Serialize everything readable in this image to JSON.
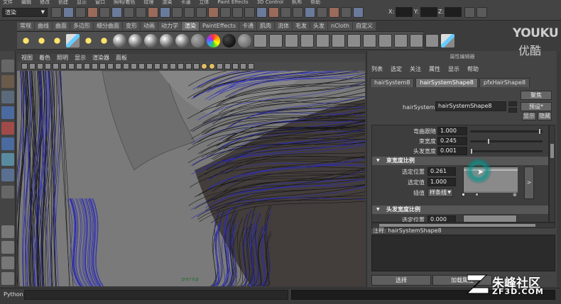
{
  "menubar": [
    "文件",
    "编辑",
    "修改",
    "创建",
    "显示",
    "窗口",
    "照明/着色",
    "纹理",
    "渲染",
    "卡通",
    "立体",
    "Paint Effects",
    "3D Control",
    "帆布",
    "帮助"
  ],
  "status": {
    "mode": "渲染",
    "x_label": "X:",
    "y_label": "Y:",
    "z_label": "Z:"
  },
  "shelf": {
    "tabs": [
      "常规",
      "曲线",
      "曲面",
      "多边形",
      "细分曲面",
      "变形",
      "动画",
      "动力学",
      "渲染",
      "PaintEffects",
      "卡通",
      "肌肉",
      "流体",
      "毛发",
      "头发",
      "nCloth",
      "自定义"
    ],
    "active_tab_index": 8
  },
  "viewport": {
    "menu": [
      "视图",
      "着色",
      "照明",
      "显示",
      "渲染器",
      "面板"
    ],
    "camera_label": "persp"
  },
  "attribute_editor": {
    "title": "属性编辑器",
    "menu": [
      "列表",
      "选定",
      "关注",
      "属性",
      "显示",
      "帮助"
    ],
    "tabs": [
      "hairSystem8",
      "hairSystemShape8",
      "pfxHairShape8"
    ],
    "active_tab_index": 1,
    "focus_button": "聚焦",
    "presets_button": "预设*",
    "show_button": "显示",
    "hide_button": "隐藏",
    "node_label": "hairSystem:",
    "node_value": "hairSystemShape8",
    "attributes": [
      {
        "label": "弯曲跟随",
        "value": "1.000",
        "fraction": 1.0
      },
      {
        "label": "束宽度",
        "value": "0.245",
        "fraction": 0.245
      },
      {
        "label": "头发宽度",
        "value": "0.001",
        "fraction": 0.001
      }
    ],
    "section1": {
      "title": "束宽度比例",
      "selected_position_label": "选定位置",
      "selected_position_value": "0.261",
      "selected_value_label": "选定值",
      "selected_value_value": "1.000",
      "interpolation_label": "插值",
      "interpolation_value": "样条线",
      "expand_label": ">"
    },
    "section2": {
      "title": "头发宽度比例",
      "selected_position_label": "选定位置",
      "selected_position_value": "0.000"
    },
    "notes_label": "注释: hairSystemShape8",
    "select_button": "选择",
    "load_button": "加载属性"
  },
  "command_line": {
    "label": "Python"
  },
  "watermarks": {
    "youku_top": "YOUKU",
    "youku_bottom": "优酷",
    "site_name": "朱峰社区",
    "site_url": "ZF3D.COM"
  }
}
